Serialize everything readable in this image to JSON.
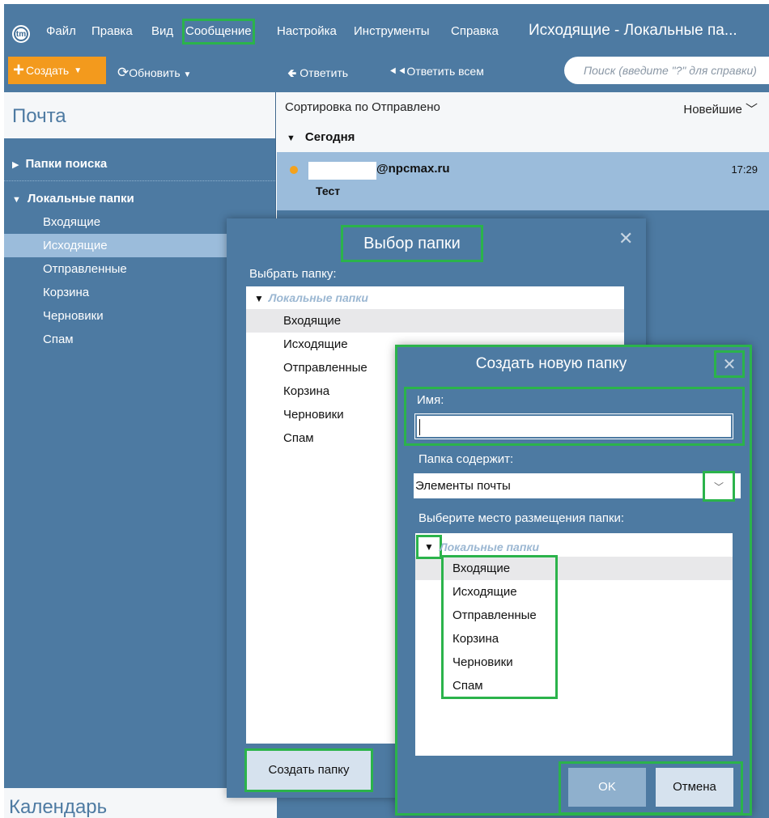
{
  "menubar": {
    "app_icon": "tm",
    "items": [
      "Файл",
      "Правка",
      "Вид",
      "Сообщение",
      "Настройка",
      "Инструменты",
      "Справка"
    ],
    "window_title": "Исходящие - Локальные па..."
  },
  "toolbar": {
    "create": "Создать",
    "refresh": "Обновить",
    "reply": "Ответить",
    "reply_all": "Ответить всем",
    "search_placeholder": "Поиск (введите \"?\" для справки)"
  },
  "sidebar": {
    "header": "Почта",
    "search_folders": "Папки поиска",
    "local_folders": "Локальные папки",
    "folders": [
      "Входящие",
      "Исходящие",
      "Отправленные",
      "Корзина",
      "Черновики",
      "Спам"
    ],
    "active_folder": "Исходящие",
    "calendar": "Календарь"
  },
  "message_list": {
    "sort_label": "Сортировка по Отправлено",
    "sort_order": "Новейшие",
    "group": "Сегодня",
    "message": {
      "from": "@npcmax.ru",
      "time": "17:29",
      "subject": "Тест"
    }
  },
  "select_folder_dialog": {
    "title": "Выбор папки",
    "label": "Выбрать папку:",
    "root": "Локальные папки",
    "folders": [
      "Входящие",
      "Исходящие",
      "Отправленные",
      "Корзина",
      "Черновики",
      "Спам"
    ],
    "create_button": "Создать папку"
  },
  "new_folder_dialog": {
    "title": "Создать новую папку",
    "name_label": "Имя:",
    "name_value": "",
    "contains_label": "Папка содержит:",
    "contains_value": "Элементы почты",
    "location_label": "Выберите место размещения папки:",
    "root": "Локальные папки",
    "folders": [
      "Входящие",
      "Исходящие",
      "Отправленные",
      "Корзина",
      "Черновики",
      "Спам"
    ],
    "ok": "OK",
    "cancel": "Отмена"
  },
  "highlight_color": "#2bb34b",
  "accent_color": "#4d7aa2",
  "create_color": "#f39a1d"
}
